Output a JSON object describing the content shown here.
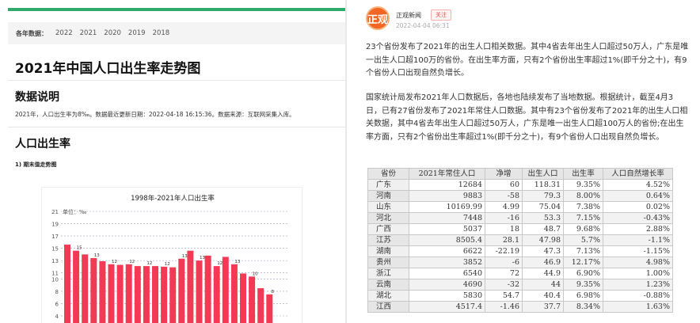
{
  "left": {
    "years_label": "各年数据：",
    "years": [
      "2022",
      "2021",
      "2020",
      "2019",
      "2018"
    ],
    "page_title": "2021年中国人口出生率走势图",
    "section_data_title": "数据说明",
    "data_note": "2021年，人口出生率为8‰。数据最近更新日期：2022-04-18 16:15:36。数据来源：互联网采集入库。",
    "section_birthrate_title": "人口出生率",
    "subsection": "1) 期末值走势图",
    "chart_title": "1998年-2021年人口出生率"
  },
  "chart_data": {
    "type": "bar",
    "title": "1998年-2021年人口出生率",
    "ylabel": "单位：‰",
    "ylim": [
      4,
      21
    ],
    "yticks": [
      4,
      6,
      8,
      10,
      11,
      13,
      15,
      17,
      19,
      21
    ],
    "grid": true,
    "bar_color": "#f23a55",
    "categories": [
      "1998",
      "1999",
      "2000",
      "2001",
      "2002",
      "2003",
      "2004",
      "2005",
      "2006",
      "2007",
      "2008",
      "2009",
      "2010",
      "2011",
      "2012",
      "2013",
      "2014",
      "2015",
      "2016",
      "2017",
      "2018",
      "2019",
      "2020",
      "2021"
    ],
    "values": [
      15.6,
      14.6,
      14.0,
      13.4,
      12.9,
      12.4,
      12.3,
      12.4,
      12.1,
      12.1,
      12.1,
      12.0,
      11.9,
      13.3,
      14.6,
      13.0,
      13.8,
      12.1,
      13.6,
      12.4,
      10.9,
      10.4,
      8.5,
      7.5
    ],
    "data_labels": [
      "",
      "15",
      "",
      "13",
      "",
      "12",
      "",
      "12",
      "",
      "12",
      "",
      "12",
      "",
      "13",
      "",
      "13",
      "",
      "12",
      "",
      "13",
      "",
      "10",
      "",
      "8"
    ]
  },
  "right": {
    "avatar_text": "正观",
    "source_name": "正观新闻",
    "follow_label": "关注",
    "date": "2022-04-04 06:31",
    "paragraph1": "23个省份发布了2021年的出生人口相关数据。其中4省去年出生人口超过50万人，广东是唯一出生人口超100万的省份。在出生率方面，只有2个省份出生率超过1%(即千分之十)，有9个省份人口出现自然负增长。",
    "paragraph2": "国家统计局发布2021年人口数据后，各地也陆续发布了当地数据。根据统计，截至4月3日，已有27省份发布了2021年常住人口数据。其中有23个省份发布了2021年的出生人口相关数据，其中4省去年出生人口超过50万人，广东是唯一出生人口超100万人的省份;在出生率方面，只有2个省份出生率超过1%(即千分之十)，有9个省份人口出现自然负增长。",
    "table_headers": [
      "省份",
      "2021年常住人口",
      "净增",
      "出生人口",
      "出生率",
      "人口自然增长率"
    ],
    "table_rows": [
      [
        "广东",
        "12684",
        "60",
        "118.31",
        "9.35%",
        "4.52%"
      ],
      [
        "河南",
        "9883",
        "-58",
        "79.3",
        "8.00%",
        "0.64%"
      ],
      [
        "山东",
        "10169.99",
        "4.99",
        "75.04",
        "7.38%",
        "0.02%"
      ],
      [
        "河北",
        "7448",
        "-16",
        "53.3",
        "7.15%",
        "-0.43%"
      ],
      [
        "广西",
        "5037",
        "18",
        "48.7",
        "9.68%",
        "2.88%"
      ],
      [
        "江苏",
        "8505.4",
        "28.1",
        "47.98",
        "5.7%",
        "-1.1%"
      ],
      [
        "湖南",
        "6622",
        "-22.19",
        "47.3",
        "7.13%",
        "-1.15%"
      ],
      [
        "贵州",
        "3852",
        "-6",
        "46.9",
        "12.17%",
        "4.98%"
      ],
      [
        "浙江",
        "6540",
        "72",
        "44.9",
        "6.90%",
        "1.00%"
      ],
      [
        "云南",
        "4690",
        "-32",
        "44",
        "9.35%",
        "1.23%"
      ],
      [
        "湖北",
        "5830",
        "54.7",
        "40.4",
        "6.98%",
        "-0.88%"
      ],
      [
        "江西",
        "4517.4",
        "-1.46",
        "37.7",
        "8.34%",
        "1.63%"
      ]
    ]
  }
}
